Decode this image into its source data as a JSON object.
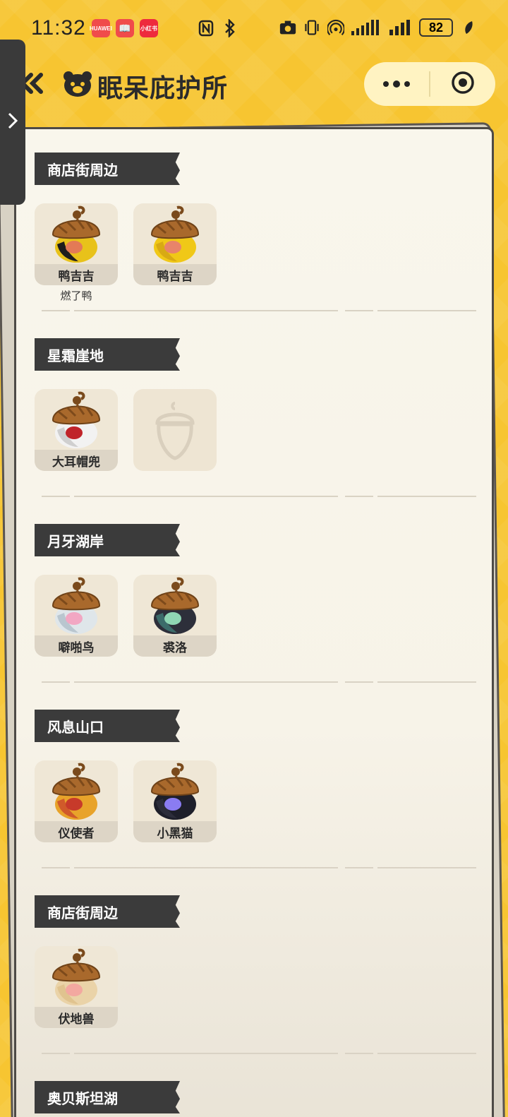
{
  "status_bar": {
    "time": "11:32",
    "apps": [
      {
        "name": "huawei-app-icon",
        "text": "HUAWEI",
        "color": "#f04b4b"
      },
      {
        "name": "book-app-icon",
        "text": "📖",
        "color": "#f04b4b"
      },
      {
        "name": "xiaohongshu-app-icon",
        "text": "小红书",
        "color": "#ee2a3d"
      }
    ],
    "battery": "82"
  },
  "header": {
    "title": "眠呆庇护所",
    "back_icon": "double-chevron-left-icon",
    "logo_icon": "bear-head-icon",
    "more_icon": "more-dots-icon",
    "close_icon": "target-circle-icon"
  },
  "sections": [
    {
      "title": "商店街周边",
      "items": [
        {
          "label": "鸭吉吉",
          "body": "#e8c21a",
          "face": "#1d1d1d",
          "accent": "#e37a56",
          "note": "燃了鸭"
        },
        {
          "label": "鸭吉吉",
          "body": "#f0c817",
          "face": "#d8aa14",
          "accent": "#e8846a"
        }
      ]
    },
    {
      "title": "星霜崖地",
      "items": [
        {
          "label": "大耳帽兜",
          "body": "#f2f2f2",
          "face": "#cfcfcf",
          "accent": "#c0242a"
        },
        {
          "empty": true
        }
      ]
    },
    {
      "title": "月牙湖岸",
      "items": [
        {
          "label": "噼啪鸟",
          "body": "#dfe6ea",
          "face": "#b9c6cf",
          "accent": "#f2a7c3"
        },
        {
          "label": "裘洛",
          "body": "#2d2f3a",
          "face": "#3c6c6a",
          "accent": "#8fd7b4"
        }
      ]
    },
    {
      "title": "风息山口",
      "items": [
        {
          "label": "仪使者",
          "body": "#e8a32a",
          "face": "#d05a2a",
          "accent": "#c73a2a"
        },
        {
          "label": "小黑猫",
          "body": "#1e1f2a",
          "face": "#2c2d3a",
          "accent": "#8a7cf2"
        }
      ]
    },
    {
      "title": "商店街周边",
      "items": [
        {
          "label": "伏地兽",
          "body": "#ead3a8",
          "face": "#e0c38f",
          "accent": "#f3a8a0"
        }
      ]
    },
    {
      "title": "奥贝斯坦湖",
      "items": []
    }
  ]
}
